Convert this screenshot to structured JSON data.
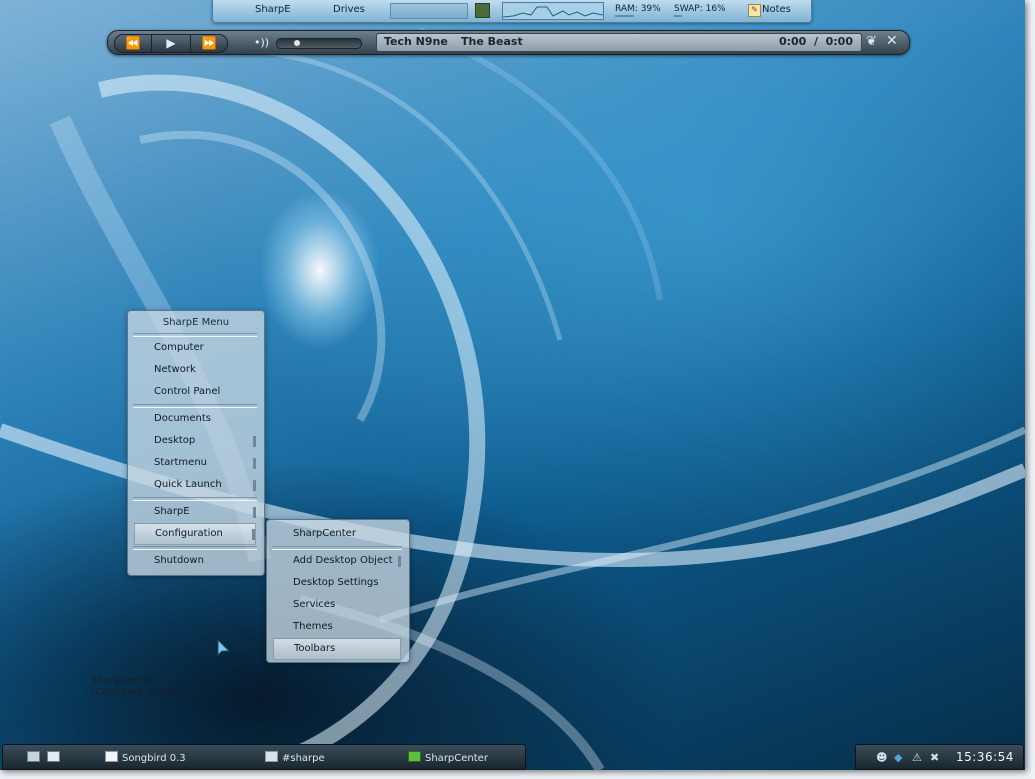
{
  "topbar": {
    "sharpe_label": "SharpE",
    "drives_label": "Drives",
    "ram_label": "RAM: 39%",
    "ram_percent": 39,
    "swap_label": "SWAP: 16%",
    "swap_percent": 16,
    "notes_label": "Notes"
  },
  "player": {
    "artist": "Tech N9ne",
    "title": "The Beast",
    "time": "0:00  /  0:00",
    "seek_fraction": 0.2
  },
  "main_menu": {
    "title": "SharpE Menu",
    "items": [
      {
        "label": "Computer"
      },
      {
        "label": "Network"
      },
      {
        "label": "Control Panel"
      },
      {
        "label": "Documents"
      },
      {
        "label": "Desktop"
      },
      {
        "label": "Startmenu"
      },
      {
        "label": "Quick Launch"
      },
      {
        "label": "SharpE"
      },
      {
        "label": "Configuration"
      },
      {
        "label": "Shutdown"
      }
    ]
  },
  "sub_menu": {
    "title": "SharpCenter",
    "items": [
      {
        "label": "Add Desktop Object"
      },
      {
        "label": "Desktop Settings"
      },
      {
        "label": "Services"
      },
      {
        "label": "Themes"
      },
      {
        "label": "Toolbars"
      }
    ]
  },
  "tooltip": {
    "line1": "SharpCenter",
    "line2": "(Configure SharpE)"
  },
  "taskbar": {
    "tasks": [
      {
        "label": "Songbird 0.3"
      },
      {
        "label": "#sharpe"
      },
      {
        "label": "SharpCenter"
      }
    ],
    "clock": "15:36:54"
  },
  "icons": {
    "prev": "fast-backward-icon",
    "play": "play-icon",
    "next": "fast-forward-icon",
    "volume": "speaker-icon",
    "notes": "notepad-icon",
    "close": "close-icon",
    "leaf": "leaf-icon"
  }
}
